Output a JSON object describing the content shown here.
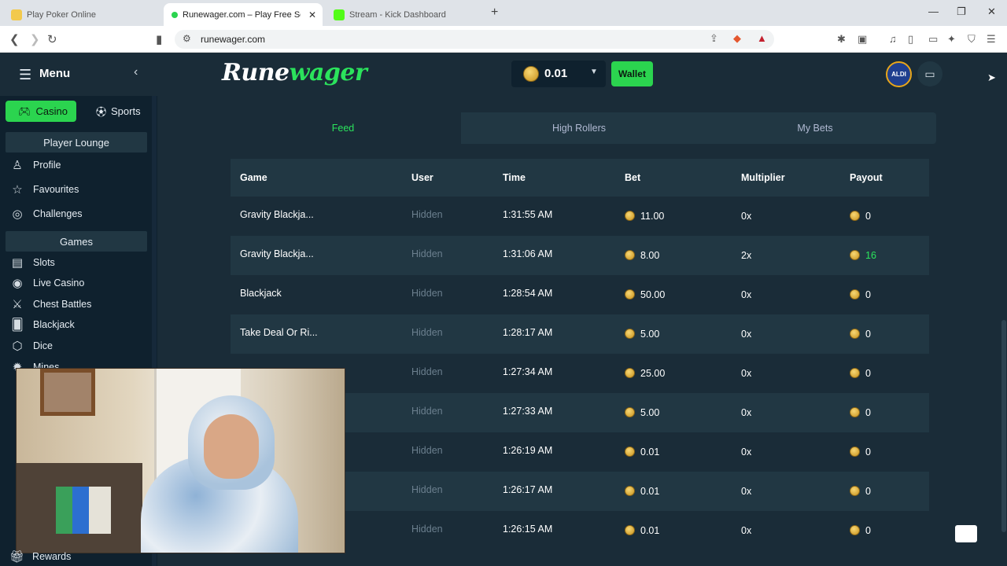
{
  "browser": {
    "tabs": [
      {
        "title": "Play Poker Online",
        "color": "#f2c94c"
      },
      {
        "title": "Runewager.com – Play Free Soci",
        "color": "#2bd44f"
      },
      {
        "title": "Stream - Kick Dashboard",
        "color": "#53fc18"
      }
    ],
    "url": "runewager.com"
  },
  "header": {
    "menu_label": "Menu",
    "logo_part1": "Rune",
    "logo_part2": "wager",
    "balance": "0.01",
    "wallet_label": "Wallet",
    "avatar_text": "ALDI"
  },
  "sidebar": {
    "casino_label": "Casino",
    "sports_label": "Sports",
    "player_lounge": "Player Lounge",
    "lounge_items": [
      "Profile",
      "Favourites",
      "Challenges"
    ],
    "games_head": "Games",
    "game_items": [
      "Slots",
      "Live Casino",
      "Chest Battles",
      "Blackjack",
      "Dice",
      "Mines"
    ],
    "rewards_label": "Rewards"
  },
  "feed": {
    "tabs": [
      "Feed",
      "High Rollers",
      "My Bets"
    ],
    "columns": [
      "Game",
      "User",
      "Time",
      "Bet",
      "Multiplier",
      "Payout"
    ],
    "rows": [
      {
        "game": "Gravity Blackja...",
        "user": "Hidden",
        "time": "1:31:55 AM",
        "bet": "11.00",
        "mult": "0x",
        "payout": "0"
      },
      {
        "game": "Gravity Blackja...",
        "user": "Hidden",
        "time": "1:31:06 AM",
        "bet": "8.00",
        "mult": "2x",
        "payout": "16"
      },
      {
        "game": "Blackjack",
        "user": "Hidden",
        "time": "1:28:54 AM",
        "bet": "50.00",
        "mult": "0x",
        "payout": "0"
      },
      {
        "game": "Take Deal Or Ri...",
        "user": "Hidden",
        "time": "1:28:17 AM",
        "bet": "5.00",
        "mult": "0x",
        "payout": "0"
      },
      {
        "game": "",
        "user": "Hidden",
        "time": "1:27:34 AM",
        "bet": "25.00",
        "mult": "0x",
        "payout": "0"
      },
      {
        "game": "",
        "user": "Hidden",
        "time": "1:27:33 AM",
        "bet": "5.00",
        "mult": "0x",
        "payout": "0"
      },
      {
        "game": "",
        "user": "Hidden",
        "time": "1:26:19 AM",
        "bet": "0.01",
        "mult": "0x",
        "payout": "0"
      },
      {
        "game": "",
        "user": "Hidden",
        "time": "1:26:17 AM",
        "bet": "0.01",
        "mult": "0x",
        "payout": "0"
      },
      {
        "game": "",
        "user": "Hidden",
        "time": "1:26:15 AM",
        "bet": "0.01",
        "mult": "0x",
        "payout": "0"
      }
    ]
  },
  "colors": {
    "accent_green": "#2be35c",
    "panel": "#213743",
    "background": "#1a2c38",
    "sidebar": "#0f212e"
  }
}
